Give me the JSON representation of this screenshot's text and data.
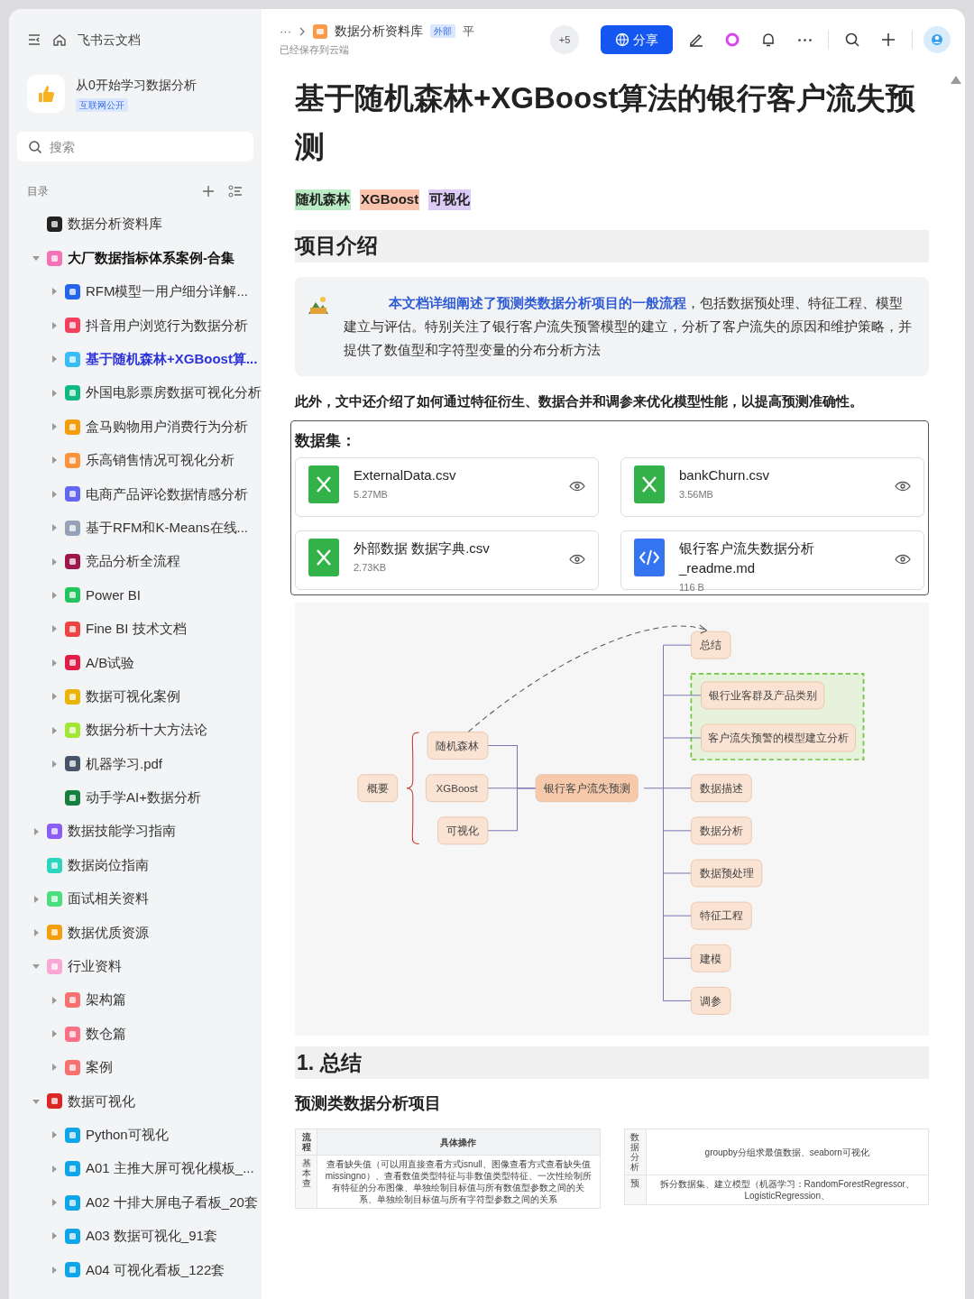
{
  "topbar": {
    "app_title": "飞书云文档",
    "breadcrumb_more": "···",
    "breadcrumb": "数据分析资料库",
    "badge": "外部",
    "pin": "平",
    "save_status": "已经保存到云端",
    "collaborators": "+5",
    "share": "分享"
  },
  "sidebar": {
    "space_title": "从0开始学习数据分析",
    "space_badge": "互联网公开",
    "search_placeholder": "搜索",
    "toc_label": "目录",
    "items": [
      {
        "label": "数据分析资料库",
        "expandable": false,
        "selected": false,
        "color": "#222222"
      },
      {
        "label": "大厂数据指标体系案例-合集",
        "expandable": true,
        "expanded": true,
        "selected": false,
        "color": "#f472b6",
        "children": [
          {
            "label": "RFM模型一用户细分详解...",
            "expandable": true,
            "expanded": false,
            "selected": false,
            "color": "#2563eb"
          },
          {
            "label": "抖音用户浏览行为数据分析",
            "expandable": true,
            "expanded": false,
            "selected": false,
            "color": "#f43f5e"
          },
          {
            "label": "基于随机森林+XGBoost算...",
            "expandable": true,
            "expanded": false,
            "selected": true,
            "color": "#38bdf8"
          },
          {
            "label": "外国电影票房数据可视化分析",
            "expandable": true,
            "expanded": false,
            "selected": false,
            "color": "#10b981"
          },
          {
            "label": "盒马购物用户消费行为分析",
            "expandable": true,
            "expanded": false,
            "selected": false,
            "color": "#f59e0b"
          },
          {
            "label": "乐高销售情况可视化分析",
            "expandable": true,
            "expanded": false,
            "selected": false,
            "color": "#fb923c"
          },
          {
            "label": "电商产品评论数据情感分析",
            "expandable": true,
            "expanded": false,
            "selected": false,
            "color": "#6366f1"
          },
          {
            "label": "基于RFM和K-Means在线...",
            "expandable": true,
            "expanded": false,
            "selected": false,
            "color": "#94a3b8"
          },
          {
            "label": "竞品分析全流程",
            "expandable": true,
            "expanded": false,
            "selected": false,
            "color": "#9d174d"
          },
          {
            "label": "Power BI",
            "expandable": true,
            "expanded": false,
            "selected": false,
            "color": "#22c55e"
          },
          {
            "label": "Fine BI 技术文档",
            "expandable": true,
            "expanded": false,
            "selected": false,
            "color": "#ef4444"
          },
          {
            "label": "A/B试验",
            "expandable": true,
            "expanded": false,
            "selected": false,
            "color": "#e11d48"
          },
          {
            "label": "数据可视化案例",
            "expandable": true,
            "expanded": false,
            "selected": false,
            "color": "#eab308"
          },
          {
            "label": "数据分析十大方法论",
            "expandable": true,
            "expanded": false,
            "selected": false,
            "color": "#a3e635"
          },
          {
            "label": "机器学习.pdf",
            "expandable": true,
            "expanded": false,
            "selected": false,
            "color": "#475569"
          },
          {
            "label": "动手学AI+数据分析",
            "expandable": false,
            "selected": false,
            "color": "#15803d"
          }
        ]
      },
      {
        "label": "数据技能学习指南",
        "expandable": true,
        "expanded": false,
        "selected": false,
        "color": "#8b5cf6"
      },
      {
        "label": "数据岗位指南",
        "expandable": false,
        "selected": false,
        "color": "#2dd4bf"
      },
      {
        "label": "面试相关资料",
        "expandable": true,
        "expanded": false,
        "selected": false,
        "color": "#4ade80"
      },
      {
        "label": "数据优质资源",
        "expandable": true,
        "expanded": false,
        "selected": false,
        "color": "#f59e0b"
      },
      {
        "label": "行业资料",
        "expandable": true,
        "expanded": true,
        "selected": false,
        "color": "#f9a8d4",
        "children": [
          {
            "label": "架构篇",
            "expandable": true,
            "expanded": false,
            "selected": false,
            "color": "#f87171"
          },
          {
            "label": "数仓篇",
            "expandable": true,
            "expanded": false,
            "selected": false,
            "color": "#fb7185"
          },
          {
            "label": "案例",
            "expandable": true,
            "expanded": false,
            "selected": false,
            "color": "#f87171"
          }
        ]
      },
      {
        "label": "数据可视化",
        "expandable": true,
        "expanded": true,
        "selected": false,
        "color": "#dc2626",
        "children": [
          {
            "label": "Python可视化",
            "expandable": true,
            "expanded": false,
            "selected": false,
            "color": "#0ea5e9"
          },
          {
            "label": "A01 主推大屏可视化模板_...",
            "expandable": true,
            "expanded": false,
            "selected": false,
            "color": "#0ea5e9"
          },
          {
            "label": "A02 十排大屏电子看板_20套",
            "expandable": true,
            "expanded": false,
            "selected": false,
            "color": "#0ea5e9"
          },
          {
            "label": "A03 数据可视化_91套",
            "expandable": true,
            "expanded": false,
            "selected": false,
            "color": "#0ea5e9"
          },
          {
            "label": "A04 可视化看板_122套",
            "expandable": true,
            "expanded": false,
            "selected": false,
            "color": "#0ea5e9"
          }
        ]
      }
    ]
  },
  "document": {
    "title": "基于随机森林+XGBoost算法的银行客户流失预测",
    "tags": [
      {
        "label": "随机森林",
        "color": "#b9ecc3"
      },
      {
        "label": "XGBoost",
        "color": "#fbc2ad"
      },
      {
        "label": "可视化",
        "color": "#dccbf7"
      }
    ],
    "section_heading": "项目介绍",
    "callout": "**本文档详细阐述了预测类数据分析项目的一般流程**，包括数据预处理、特征工程、模型建立与评估。特别关注了银行客户流失预警模型的建立，分析了客户流失的原因和维护策略，并提供了数值型和字符型变量的分布分析方法",
    "paragraph": "此外，文中还介绍了如何通过特征衍生、数据合并和调参来优化模型性能，以提高预测准确性。",
    "dataset_label": "数据集：",
    "files": [
      {
        "kind": "sheet",
        "name": "ExternalData.csv",
        "size": "5.27MB"
      },
      {
        "kind": "sheet",
        "name": "bankChurn.csv",
        "size": "3.56MB"
      },
      {
        "kind": "sheet",
        "name": "外部数据 数据字典.csv",
        "size": "2.73KB"
      },
      {
        "kind": "code",
        "name": "银行客户流失数据分析_readme.md",
        "size": "116 B"
      }
    ],
    "mind_map": {
      "summary": "概要",
      "left": [
        "随机森林",
        "XGBoost",
        "可视化"
      ],
      "center": "银行客户流失预测",
      "right": [
        {
          "label": "总结",
          "grouped": false
        },
        {
          "label": "银行业客群及产品类别",
          "grouped": true
        },
        {
          "label": "客户流失预警的模型建立分析",
          "grouped": true
        },
        {
          "label": "数据描述",
          "grouped": false
        },
        {
          "label": "数据分析",
          "grouped": false
        },
        {
          "label": "数据预处理",
          "grouped": false
        },
        {
          "label": "特征工程",
          "grouped": false
        },
        {
          "label": "建模",
          "grouped": false
        },
        {
          "label": "调参",
          "grouped": false
        }
      ]
    },
    "heading_2": "1. 总结",
    "subheading": "预测类数据分析项目",
    "tables": [
      {
        "header": [
          "流程",
          "具体操作"
        ],
        "rows": [
          [
            "基本查",
            "查看缺失值（可以用直接查看方式isnull、图像查看方式查看缺失值missingno）、查看数值类型特征与非数值类型特征、一次性绘制所有特征的分布图像、单独绘制目标值与所有数值型参数之间的关系、单独绘制目标值与所有字符型参数之间的关系"
          ]
        ]
      },
      {
        "rows": [
          [
            "数据分析",
            "groupby分组求最值数据、seaborn可视化"
          ],
          [
            "预",
            "拆分数据集、建立模型（机器学习：RandomForestRegressor、LogisticRegression、"
          ]
        ]
      }
    ]
  }
}
